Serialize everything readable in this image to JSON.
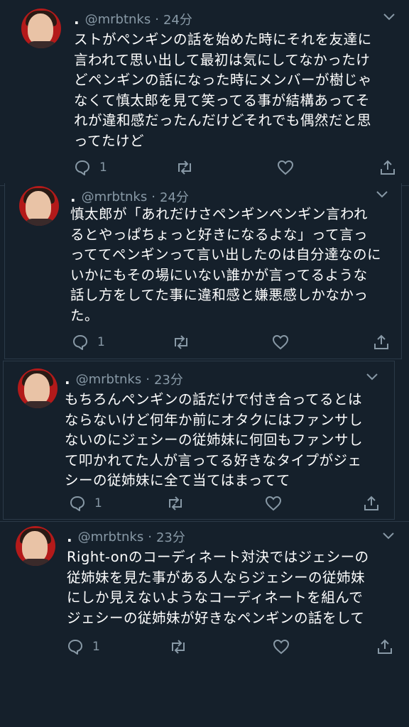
{
  "tweets": [
    {
      "dot": ".",
      "handle": "@mrbtnks",
      "separator": "·",
      "time": "24分",
      "lines": [
        "ストがペンギンの話を始めた時にそれを友達に",
        "言われて思い出して最初は気にしてなかったけ",
        "どペンギンの話になった時にメンバーが樹じゃ",
        "なくて慎太郎を見て笑ってる事が結構あってそ",
        "れが違和感だったんだけどそれでも偶然だと思",
        "ってたけど"
      ],
      "reply_count": "1"
    },
    {
      "dot": ".",
      "handle": "@mrbtnks",
      "separator": "·",
      "time": "24分",
      "lines": [
        "慎太郎が「あれだけさペンギンペンギン言われ",
        "るとやっぱちょっと好きになるよな」って言っ",
        "っててペンギンって言い出したのは自分達なのに",
        "いかにもその場にいない誰かが言ってるような",
        "話し方をしてた事に違和感と嫌悪感しかなかっ",
        "た。"
      ],
      "reply_count": "1"
    },
    {
      "dot": ".",
      "handle": "@mrbtnks",
      "separator": "·",
      "time": "23分",
      "lines": [
        "もちろんペンギンの話だけで付き合ってるとは",
        "ならないけど何年か前にオタクにはファンサし",
        "ないのにジェシーの従姉妹に何回もファンサし",
        "て叩かれてた人が言ってる好きなタイプがジェ",
        "シーの従姉妹に全て当てはまってて"
      ],
      "reply_count": "1"
    },
    {
      "dot": ".",
      "handle": "@mrbtnks",
      "separator": "·",
      "time": "23分",
      "lines": [
        "Right-onのコーディネート対決ではジェシーの",
        "従姉妹を見た事がある人ならジェシーの従姉妹",
        "にしか見えないようなコーディネートを組んで",
        "ジェシーの従姉妹が好きなペンギンの話をして"
      ],
      "reply_count": "1"
    }
  ],
  "icons": {
    "reply": "reply-icon",
    "retweet": "retweet-icon",
    "like": "heart-icon",
    "share": "share-icon",
    "menu": "chevron-down-icon"
  },
  "colors": {
    "background": "#15202b",
    "muted": "#8899a6",
    "text": "#ffffff",
    "avatar_bg": "#b31a1a"
  }
}
